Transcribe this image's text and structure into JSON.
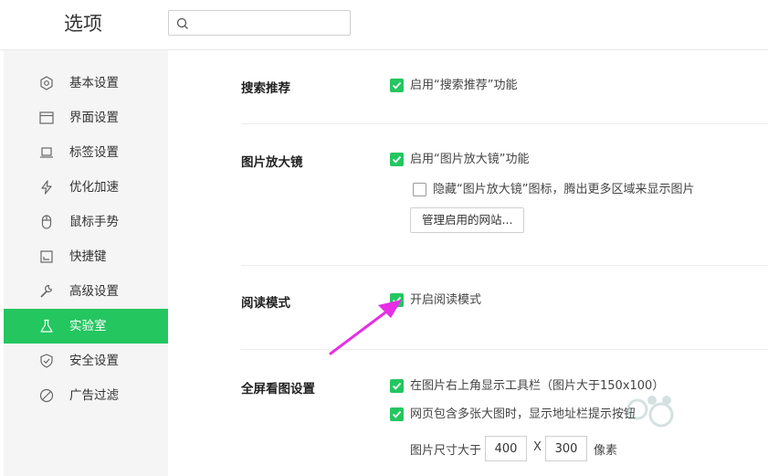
{
  "header": {
    "title": "选项",
    "search": {
      "value": "",
      "placeholder": "",
      "icon": "search-icon"
    }
  },
  "sidebar": {
    "items": [
      {
        "label": "基本设置",
        "icon": "settings-hex-icon",
        "active": false
      },
      {
        "label": "界面设置",
        "icon": "window-icon",
        "active": false
      },
      {
        "label": "标签设置",
        "icon": "laptop-icon",
        "active": false
      },
      {
        "label": "优化加速",
        "icon": "lightning-icon",
        "active": false
      },
      {
        "label": "鼠标手势",
        "icon": "mouse-icon",
        "active": false
      },
      {
        "label": "快捷键",
        "icon": "keyboard-icon",
        "active": false
      },
      {
        "label": "高级设置",
        "icon": "wrench-icon",
        "active": false
      },
      {
        "label": "实验室",
        "icon": "flask-icon",
        "active": true
      },
      {
        "label": "安全设置",
        "icon": "shield-icon",
        "active": false
      },
      {
        "label": "广告过滤",
        "icon": "block-icon",
        "active": false
      }
    ]
  },
  "main": {
    "search_recommend": {
      "title": "搜索推荐",
      "option": {
        "label": "启用“搜索推荐”功能",
        "checked": true
      }
    },
    "image_magnifier": {
      "title": "图片放大镜",
      "option1": {
        "label": "启用“图片放大镜”功能",
        "checked": true
      },
      "option2": {
        "label": "隐藏“图片放大镜”图标，腾出更多区域来显示图片",
        "checked": false
      },
      "manage_button": "管理启用的网站..."
    },
    "reading_mode": {
      "title": "阅读模式",
      "option": {
        "label": "开启阅读模式",
        "checked": true
      }
    },
    "fullscreen_image": {
      "title": "全屏看图设置",
      "option1": {
        "label": "在图片右上角显示工具栏（图片大于150x100）",
        "checked": true
      },
      "option2": {
        "label": "网页包含多张大图时，显示地址栏提示按钮",
        "checked": true
      },
      "size_label": "图片尺寸大于",
      "width_value": "400",
      "times": "X",
      "height_value": "300",
      "unit": "像素"
    }
  },
  "colors": {
    "accent": "#24c660",
    "annotation_arrow": "#e62ee6"
  }
}
